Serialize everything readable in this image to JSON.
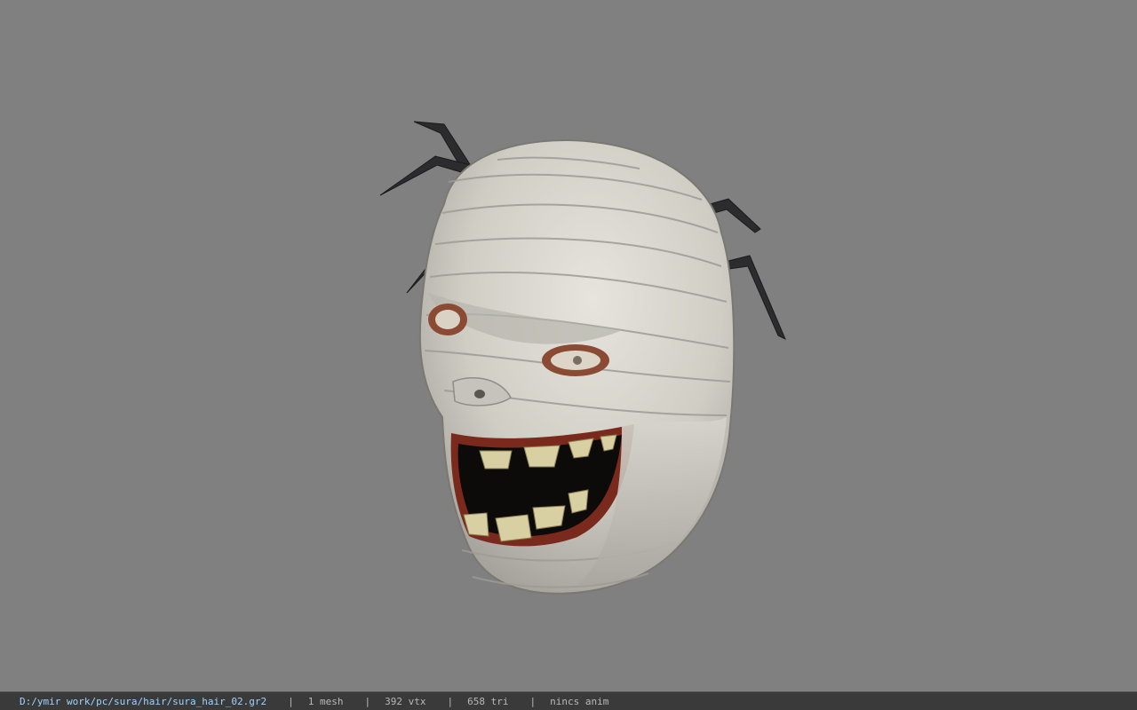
{
  "viewer": {
    "background_color": "#808080",
    "model_name": "sura_hair_02",
    "model_icon": "mummy-head-model"
  },
  "status_bar": {
    "file_path": "D:/ymir work/pc/sura/hair/sura_hair_02.gr2",
    "separator": "|",
    "mesh": "1 mesh",
    "vertices": "392 vtx",
    "triangles": "658 tri",
    "animation": "nincs anim",
    "path_color": "#9fd3ff",
    "text_color": "#b9b9b9"
  }
}
